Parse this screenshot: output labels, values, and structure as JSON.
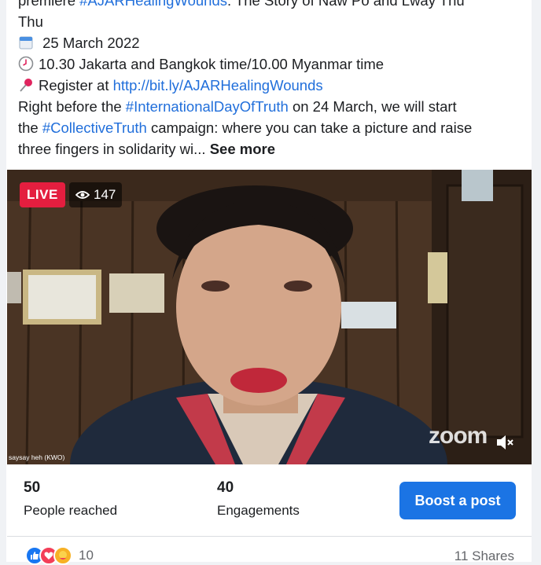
{
  "post": {
    "line1_prefix": "premiere ",
    "line1_hashtag": "#AJARHealingWounds",
    "line1_suffix": ": The Story of Naw Po and Lway Thu",
    "line2": "Thu",
    "date": "25 March 2022",
    "time": "10.30 Jakarta and Bangkok time/10.00 Myanmar time",
    "register_prefix": "Register at ",
    "register_link": "http://bit.ly/AJARHealingWounds",
    "line6_prefix": "Right before the ",
    "line6_hashtag": "#InternationalDayOfTruth",
    "line6_suffix": " on 24 March, we will start",
    "line7_prefix": "the ",
    "line7_hashtag": "#CollectiveTruth",
    "line7_suffix": " campaign: where you can take a picture and raise",
    "line8": "three fingers in solidarity wi... ",
    "see_more": "See more"
  },
  "video": {
    "live_label": "LIVE",
    "viewer_count": "147",
    "speaker_name": "saysay heh (KWO)",
    "watermark": "zoom"
  },
  "stats": {
    "reached_count": "50",
    "reached_label": "People reached",
    "engagements_count": "40",
    "engagements_label": "Engagements",
    "boost_label": "Boost a post"
  },
  "footer": {
    "reactions_count": "10",
    "shares": "11 Shares"
  },
  "colors": {
    "link": "#216fdb",
    "live": "#e41e3f",
    "boost": "#1b74e4"
  },
  "icons": [
    "calendar-icon",
    "clock-icon",
    "pushpin-icon",
    "eye-icon",
    "muted-speaker-icon",
    "like-reaction-icon",
    "love-reaction-icon",
    "care-reaction-icon"
  ]
}
